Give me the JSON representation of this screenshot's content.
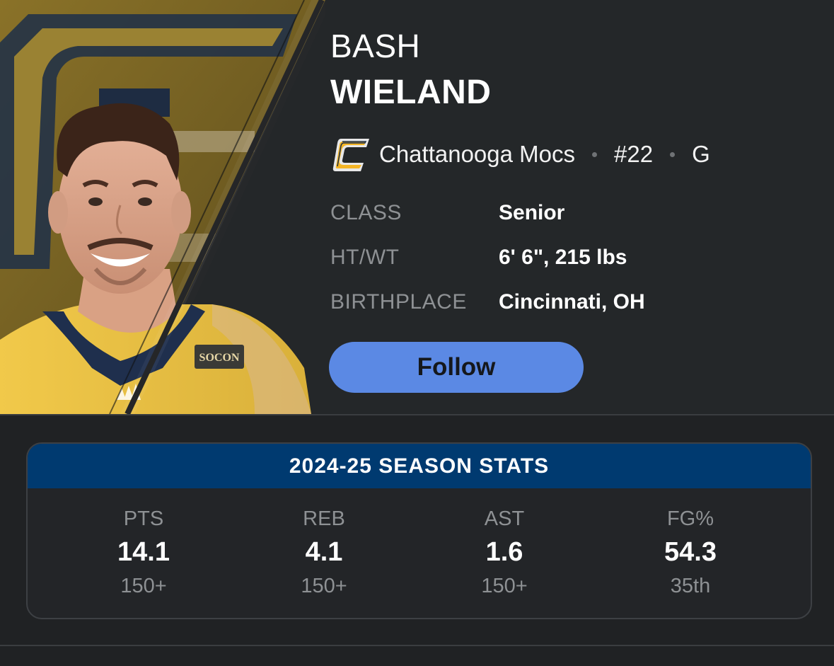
{
  "player": {
    "first_name": "BASH",
    "last_name": "WIELAND",
    "team": "Chattanooga Mocs",
    "number": "#22",
    "position": "G"
  },
  "details": [
    {
      "label": "CLASS",
      "value": "Senior"
    },
    {
      "label": "HT/WT",
      "value": "6' 6\", 215 lbs"
    },
    {
      "label": "BIRTHPLACE",
      "value": "Cincinnati, OH"
    }
  ],
  "follow_label": "Follow",
  "season_stats": {
    "title": "2024-25 SEASON STATS",
    "stats": [
      {
        "label": "PTS",
        "value": "14.1",
        "rank": "150+"
      },
      {
        "label": "REB",
        "value": "4.1",
        "rank": "150+"
      },
      {
        "label": "AST",
        "value": "1.6",
        "rank": "150+"
      },
      {
        "label": "FG%",
        "value": "54.3",
        "rank": "35th"
      }
    ]
  },
  "photo_logo_text": "SOCON",
  "colors": {
    "background": "#202224",
    "header_bg": "#242729",
    "accent_blue": "#5b89e4",
    "stats_header": "#003a70",
    "team_gold": "#f4b526",
    "muted_text": "#8e9194"
  }
}
